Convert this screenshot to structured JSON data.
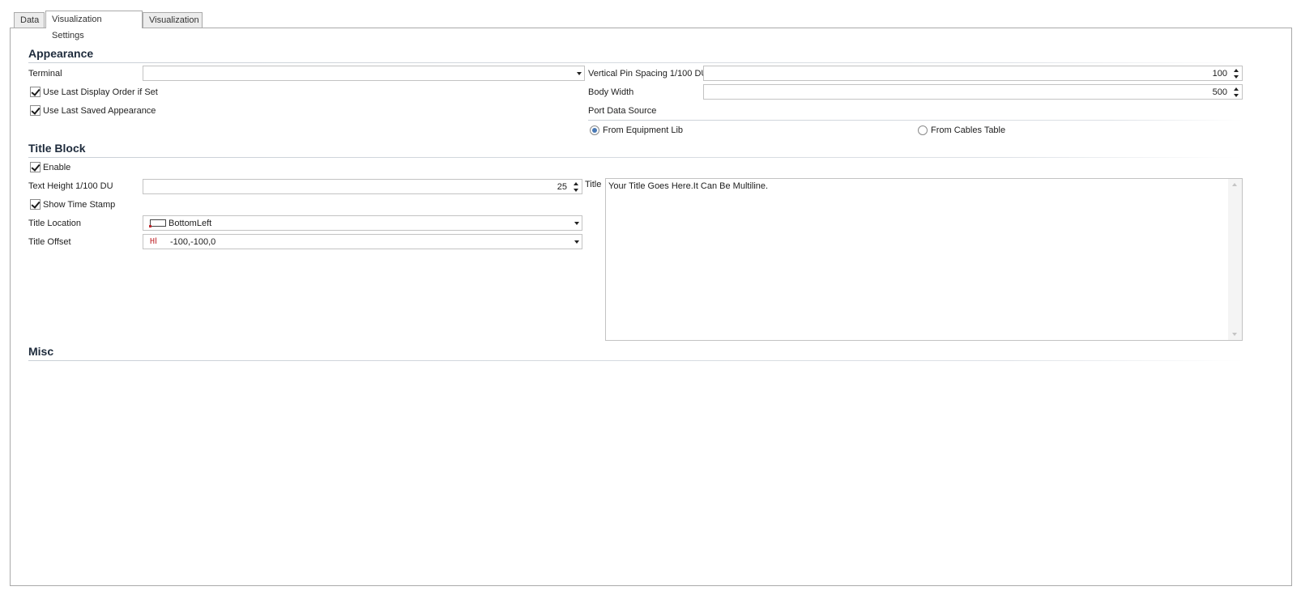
{
  "tabs": [
    {
      "label": "Data"
    },
    {
      "label": "Visualization Settings",
      "active": true
    },
    {
      "label": "Visualization"
    }
  ],
  "sections": {
    "appearance": "Appearance",
    "title_block": "Title Block",
    "misc": "Misc"
  },
  "appearance": {
    "terminal_label": "Terminal",
    "terminal_value": "",
    "use_last_display_order_label": "Use Last Display Order if Set",
    "use_last_display_order_checked": true,
    "use_last_saved_appearance_label": "Use Last Saved Appearance",
    "use_last_saved_appearance_checked": true,
    "vertical_pin_spacing_label": "Vertical Pin Spacing 1/100 DU",
    "vertical_pin_spacing_value": "100",
    "body_width_label": "Body Width",
    "body_width_value": "500",
    "port_data_source_label": "Port Data Source",
    "port_data_source_options": [
      "From Equipment Lib",
      "From Cables Table"
    ],
    "port_data_source_selected": "From Equipment Lib"
  },
  "title_block": {
    "enable_label": "Enable",
    "enable_checked": true,
    "text_height_label": "Text Height 1/100 DU",
    "text_height_value": "25",
    "show_time_stamp_label": "Show Time Stamp",
    "show_time_stamp_checked": true,
    "title_location_label": "Title Location",
    "title_location_value": "BottomLeft",
    "title_offset_label": "Title Offset",
    "title_offset_value": "-100,-100,0",
    "title_label": "Title",
    "title_value": "Your Title Goes Here.It Can Be Multiline."
  },
  "colors": {
    "border": "#a9a9a9",
    "section_title": "#1e2b3c",
    "icon_accent": "#c0282d",
    "radio_dot": "#4a79b5"
  },
  "icons": {
    "title_location": "bottom-left-anchor-icon",
    "title_offset": "offset-icon"
  }
}
